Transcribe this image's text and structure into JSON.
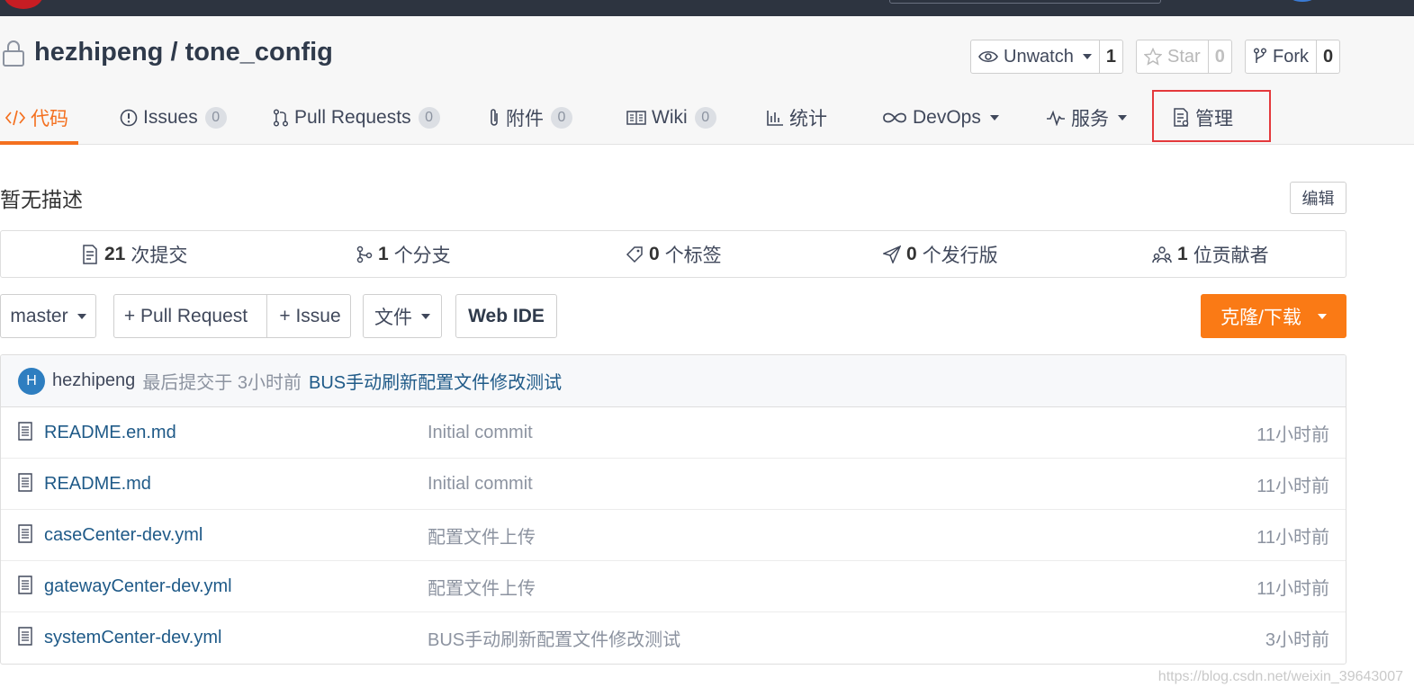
{
  "repo": {
    "owner": "hezhipeng",
    "separator": " / ",
    "name": "tone_config"
  },
  "actions": {
    "watch_label": "Unwatch",
    "watch_count": "1",
    "star_label": "Star",
    "star_count": "0",
    "fork_label": "Fork",
    "fork_count": "0"
  },
  "tabs": [
    {
      "label": "代码"
    },
    {
      "label": "Issues",
      "badge": "0"
    },
    {
      "label": "Pull Requests",
      "badge": "0"
    },
    {
      "label": "附件",
      "badge": "0"
    },
    {
      "label": "Wiki",
      "badge": "0"
    },
    {
      "label": "统计"
    },
    {
      "label": "DevOps"
    },
    {
      "label": "服务"
    },
    {
      "label": "管理"
    }
  ],
  "description": "暂无描述",
  "edit_label": "编辑",
  "stats": [
    {
      "count": "21",
      "label": "次提交"
    },
    {
      "count": "1",
      "label": "个分支"
    },
    {
      "count": "0",
      "label": "个标签"
    },
    {
      "count": "0",
      "label": "个发行版"
    },
    {
      "count": "1",
      "label": "位贡献者"
    }
  ],
  "toolbar": {
    "branch": "master",
    "pull_request": "+ Pull Request",
    "issue": "+ Issue",
    "file": "文件",
    "web_ide": "Web IDE",
    "clone": "克隆/下载"
  },
  "last_commit": {
    "avatar_letter": "H",
    "author": "hezhipeng",
    "meta": "最后提交于 3小时前",
    "message": "BUS手动刷新配置文件修改测试"
  },
  "files": [
    {
      "name": "README.en.md",
      "message": "Initial commit",
      "time": "11小时前"
    },
    {
      "name": "README.md",
      "message": "Initial commit",
      "time": "11小时前"
    },
    {
      "name": "caseCenter-dev.yml",
      "message": "配置文件上传",
      "time": "11小时前"
    },
    {
      "name": "gatewayCenter-dev.yml",
      "message": "配置文件上传",
      "time": "11小时前"
    },
    {
      "name": "systemCenter-dev.yml",
      "message": "BUS手动刷新配置文件修改测试",
      "time": "3小时前"
    }
  ],
  "watermark": "https://blog.csdn.net/weixin_39643007",
  "colors": {
    "accent": "#f4701f",
    "clone_button": "#fa7a15",
    "link": "#1f5a88",
    "highlight": "#e4393c"
  }
}
